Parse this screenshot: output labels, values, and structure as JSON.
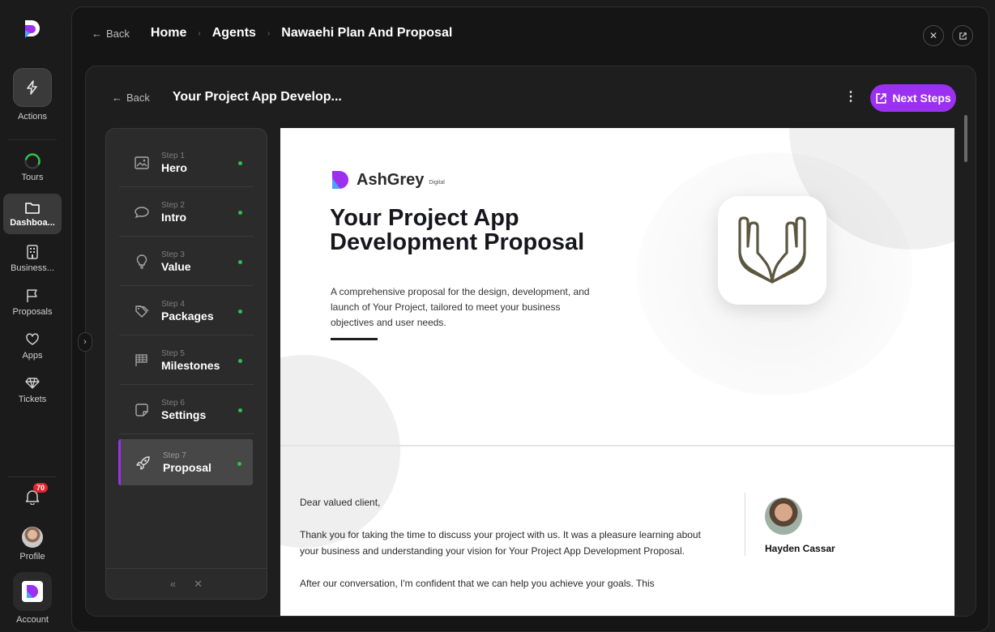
{
  "rail": {
    "items": [
      {
        "label": "Actions",
        "icon": "bolt-icon"
      },
      {
        "label": "Tours",
        "icon": "progress-ring-icon"
      },
      {
        "label": "Dashboa...",
        "icon": "folder-icon"
      },
      {
        "label": "Business...",
        "icon": "building-icon"
      },
      {
        "label": "Proposals",
        "icon": "flag-icon"
      },
      {
        "label": "Apps",
        "icon": "heart-icon"
      },
      {
        "label": "Tickets",
        "icon": "diamond-icon"
      }
    ],
    "notifications_count": "70",
    "profile_label": "Profile",
    "account_label": "Account"
  },
  "topbar": {
    "back_label": "Back",
    "breadcrumb": [
      "Home",
      "Agents",
      "Nawaehi Plan And Proposal"
    ]
  },
  "inner": {
    "back_label": "Back",
    "title": "Your Project App Develop...",
    "next_label": "Next Steps"
  },
  "steps": [
    {
      "num": "Step 1",
      "name": "Hero",
      "icon": "image-icon"
    },
    {
      "num": "Step 2",
      "name": "Intro",
      "icon": "chat-bubble-icon"
    },
    {
      "num": "Step 3",
      "name": "Value",
      "icon": "lightbulb-icon"
    },
    {
      "num": "Step 4",
      "name": "Packages",
      "icon": "tags-icon"
    },
    {
      "num": "Step 5",
      "name": "Milestones",
      "icon": "flag-checkered-icon"
    },
    {
      "num": "Step 6",
      "name": "Settings",
      "icon": "note-icon"
    },
    {
      "num": "Step 7",
      "name": "Proposal",
      "icon": "rocket-icon"
    }
  ],
  "document": {
    "brand_name": "AshGrey",
    "brand_sub": "Digital",
    "title": "Your Project App Development Proposal",
    "description": "A comprehensive proposal for the design, development, and launch of Your Project, tailored to meet your business objectives and user needs.",
    "letter": [
      "Dear valued client,",
      "Thank you for taking the time to discuss your project with us. It was a pleasure learning about your business and understanding your vision for Your Project App Development Proposal.",
      "After our conversation, I'm confident that we can help you achieve your goals. This"
    ],
    "author": "Hayden Cassar"
  },
  "colors": {
    "accent": "#9b30f0",
    "status_dot": "#2fbf4f",
    "badge": "#e0262d"
  }
}
